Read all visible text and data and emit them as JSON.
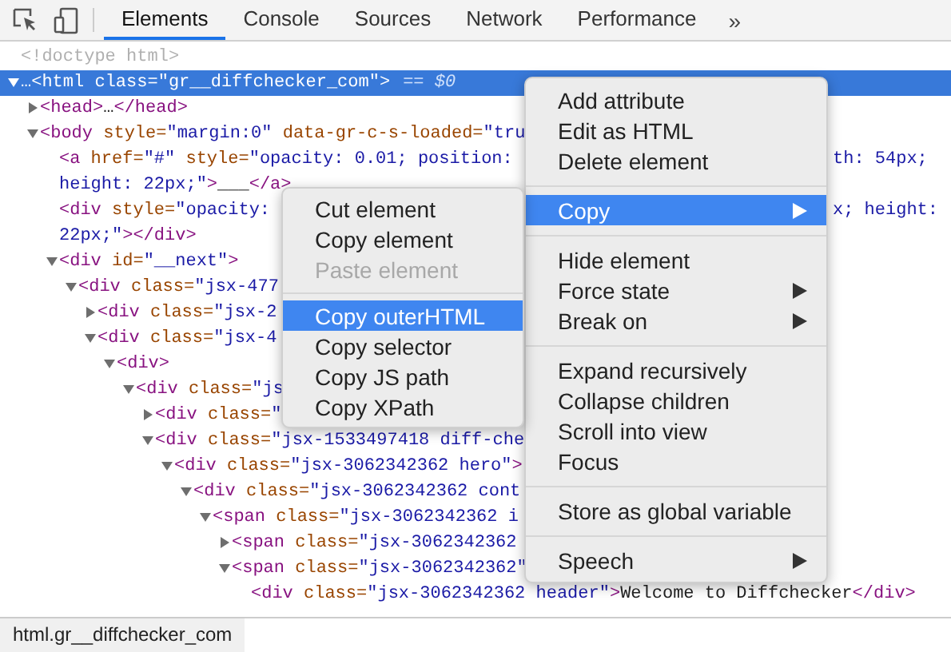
{
  "toolbar": {
    "tabs": [
      {
        "label": "Elements",
        "selected": true
      },
      {
        "label": "Console",
        "selected": false
      },
      {
        "label": "Sources",
        "selected": false
      },
      {
        "label": "Network",
        "selected": false
      },
      {
        "label": "Performance",
        "selected": false
      }
    ],
    "more": "»"
  },
  "tree": [
    {
      "kind": "doctype",
      "selected": false,
      "lines": [
        {
          "text": "<!doctype html>"
        }
      ]
    },
    {
      "kind": "element",
      "expanded": true,
      "selected": true,
      "lines": [
        {
          "text": "…<html class=\"gr__diffchecker_com\">"
        }
      ],
      "console_ref": "== $0",
      "children": [
        {
          "kind": "element",
          "expanded": false,
          "selected": false,
          "lines": [
            {
              "text": "<head>…</head>"
            }
          ]
        },
        {
          "kind": "element",
          "expanded": true,
          "selected": false,
          "lines": [
            {
              "text": "<body style=\"margin:0\" data-gr-c-s-loaded=\"tru"
            }
          ],
          "children": [
            {
              "kind": "leaf",
              "selected": false,
              "lines": [
                {
                  "text": "<a href=\"#\" style=\"opacity: 0.01; position:",
                  "tail": "th: 54px;"
                },
                {
                  "text": "height: 22px;\">___</a>"
                }
              ]
            },
            {
              "kind": "leaf",
              "selected": false,
              "lines": [
                {
                  "text": "<div style=\"opacity:",
                  "tail": "x; height:"
                },
                {
                  "text": "22px;\"></div>"
                }
              ]
            },
            {
              "kind": "element",
              "expanded": true,
              "selected": false,
              "lines": [
                {
                  "text": "<div id=\"__next\">"
                }
              ],
              "children": [
                {
                  "kind": "element",
                  "expanded": true,
                  "selected": false,
                  "lines": [
                    {
                      "text": "<div class=\"jsx-477"
                    }
                  ],
                  "children": [
                    {
                      "kind": "element",
                      "expanded": false,
                      "selected": false,
                      "lines": [
                        {
                          "text": "<div class=\"jsx-2"
                        }
                      ]
                    },
                    {
                      "kind": "element",
                      "expanded": true,
                      "selected": false,
                      "lines": [
                        {
                          "text": "<div class=\"jsx-4"
                        }
                      ],
                      "children": [
                        {
                          "kind": "element",
                          "expanded": true,
                          "selected": false,
                          "lines": [
                            {
                              "text": "<div>"
                            }
                          ],
                          "children": [
                            {
                              "kind": "element",
                              "expanded": true,
                              "selected": false,
                              "lines": [
                                {
                                  "text": "<div class=\"js"
                                }
                              ],
                              "children": [
                                {
                                  "kind": "element",
                                  "expanded": false,
                                  "selected": false,
                                  "lines": [
                                    {
                                      "text": "<div class=\""
                                    }
                                  ]
                                },
                                {
                                  "kind": "element",
                                  "expanded": true,
                                  "selected": false,
                                  "lines": [
                                    {
                                      "text": "<div class=\"jsx-1533497418 diff-che"
                                    }
                                  ],
                                  "children": [
                                    {
                                      "kind": "element",
                                      "expanded": true,
                                      "selected": false,
                                      "lines": [
                                        {
                                          "text": "<div class=\"jsx-3062342362 hero\">"
                                        }
                                      ],
                                      "children": [
                                        {
                                          "kind": "element",
                                          "expanded": true,
                                          "selected": false,
                                          "lines": [
                                            {
                                              "text": "<div class=\"jsx-3062342362 cont"
                                            }
                                          ],
                                          "children": [
                                            {
                                              "kind": "element",
                                              "expanded": true,
                                              "selected": false,
                                              "lines": [
                                                {
                                                  "text": "<span class=\"jsx-3062342362 i"
                                                }
                                              ],
                                              "children": [
                                                {
                                                  "kind": "element",
                                                  "expanded": false,
                                                  "selected": false,
                                                  "lines": [
                                                    {
                                                      "text": "<span class=\"jsx-3062342362"
                                                    }
                                                  ]
                                                },
                                                {
                                                  "kind": "element",
                                                  "expanded": true,
                                                  "selected": false,
                                                  "lines": [
                                                    {
                                                      "text": "<span class=\"jsx-3062342362\""
                                                    }
                                                  ],
                                                  "children": [
                                                    {
                                                      "kind": "leaf",
                                                      "selected": false,
                                                      "lines": [
                                                        {
                                                          "text": "<div class=\"jsx-3062342362 header\">Welcome to Diffchecker</div>"
                                                        }
                                                      ]
                                                    }
                                                  ]
                                                }
                                              ]
                                            }
                                          ]
                                        }
                                      ]
                                    }
                                  ]
                                }
                              ]
                            }
                          ]
                        }
                      ]
                    }
                  ]
                }
              ]
            }
          ]
        }
      ]
    }
  ],
  "context_menu": {
    "groups": [
      [
        {
          "label": "Add attribute",
          "selected": false,
          "submenu": false
        },
        {
          "label": "Edit as HTML",
          "selected": false,
          "submenu": false
        },
        {
          "label": "Delete element",
          "selected": false,
          "submenu": false
        }
      ],
      [
        {
          "label": "Copy",
          "selected": true,
          "submenu": true
        }
      ],
      [
        {
          "label": "Hide element",
          "selected": false,
          "submenu": false
        },
        {
          "label": "Force state",
          "selected": false,
          "submenu": true
        },
        {
          "label": "Break on",
          "selected": false,
          "submenu": true
        }
      ],
      [
        {
          "label": "Expand recursively",
          "selected": false,
          "submenu": false
        },
        {
          "label": "Collapse children",
          "selected": false,
          "submenu": false
        },
        {
          "label": "Scroll into view",
          "selected": false,
          "submenu": false
        },
        {
          "label": "Focus",
          "selected": false,
          "submenu": false
        }
      ],
      [
        {
          "label": "Store as global variable",
          "selected": false,
          "submenu": false
        }
      ],
      [
        {
          "label": "Speech",
          "selected": false,
          "submenu": true
        }
      ]
    ]
  },
  "copy_submenu": {
    "groups": [
      [
        {
          "label": "Cut element",
          "selected": false,
          "disabled": false
        },
        {
          "label": "Copy element",
          "selected": false,
          "disabled": false
        },
        {
          "label": "Paste element",
          "selected": false,
          "disabled": true
        }
      ],
      [
        {
          "label": "Copy outerHTML",
          "selected": true,
          "disabled": false
        },
        {
          "label": "Copy selector",
          "selected": false,
          "disabled": false
        },
        {
          "label": "Copy JS path",
          "selected": false,
          "disabled": false
        },
        {
          "label": "Copy XPath",
          "selected": false,
          "disabled": false
        }
      ]
    ]
  },
  "status_bar": {
    "breadcrumb": "html.gr__diffchecker_com"
  }
}
